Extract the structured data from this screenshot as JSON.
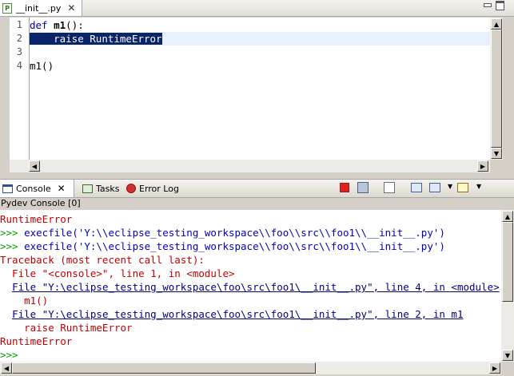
{
  "editor": {
    "tab_label": "__init__.py",
    "close_glyph": "✕",
    "line_numbers": [
      "1",
      "2",
      "3",
      "4"
    ],
    "code": {
      "l1_kw": "def",
      "l1_name": "m1",
      "l1_rest": "():",
      "l2_indent": "    ",
      "l2_text": "raise RuntimeError",
      "l4": "m1()"
    }
  },
  "view_tabs": {
    "console": "Console",
    "console_close": "✕",
    "tasks": "Tasks",
    "error_log": "Error Log"
  },
  "console": {
    "title": "Pydev Console [0]",
    "lines": {
      "l0": "RuntimeError",
      "l1_prompt": ">>> ",
      "l1_cmd": "execfile('Y:\\\\eclipse_testing_workspace\\\\foo\\\\src\\\\foo1\\\\__init__.py')",
      "l2_prompt": ">>> ",
      "l2_cmd": "execfile('Y:\\\\eclipse_testing_workspace\\\\foo\\\\src\\\\foo1\\\\__init__.py')",
      "l3": "Traceback (most recent call last):",
      "l4": "  File \"<console>\", line 1, in <module>",
      "l5_indent": "  ",
      "l5_link": "File \"Y:\\eclipse_testing_workspace\\foo\\src\\foo1\\__init__.py\", line 4, in <module>",
      "l6": "    m1()",
      "l7_indent": "  ",
      "l7_link": "File \"Y:\\eclipse_testing_workspace\\foo\\src\\foo1\\__init__.py\", line 2, in m1",
      "l8": "    raise RuntimeError",
      "l9": "RuntimeError",
      "l10_prompt": ">>>"
    }
  },
  "icons": {
    "editor_file": "python-file-icon",
    "console_tab": "console-icon",
    "tasks_tab": "tasks-icon",
    "error_log_tab": "error-log-icon",
    "toolbar": [
      "stop-icon",
      "save-icon",
      "clear-console-icon",
      "pin-console-icon",
      "display-console-icon",
      "new-console-icon"
    ]
  },
  "colors": {
    "keyword": "#0000a0",
    "selection": "#0a246a",
    "current_line": "#e8f2fe",
    "error_text": "#c00000",
    "prompt": "#00a000",
    "input_text": "#0000c0"
  }
}
